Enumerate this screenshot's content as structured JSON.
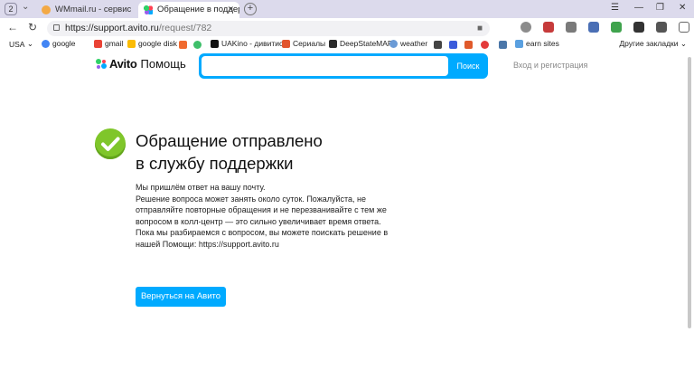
{
  "browser": {
    "tab_count": "2",
    "tabs": [
      {
        "title": "WMmail.ru - сервис почто",
        "active": false
      },
      {
        "title": "Обращение в поддержк",
        "active": true
      }
    ],
    "url_host": "https://support.avito.ru",
    "url_path": "/request/782",
    "bookmarks": [
      {
        "label": "USA"
      },
      {
        "label": "google"
      },
      {
        "label": "gmail"
      },
      {
        "label": "google disk"
      },
      {
        "label": "UAKino - дивитис"
      },
      {
        "label": "Сериалы"
      },
      {
        "label": "DeepStateMAP"
      },
      {
        "label": "weather"
      },
      {
        "label": "earn sites"
      }
    ],
    "other_bookmarks": "Другие закладки",
    "download_badge": "3"
  },
  "header": {
    "brand": "Avito",
    "help": "Помощь",
    "search_placeholder": "",
    "search_button": "Поиск",
    "login": "Вход и регистрация"
  },
  "main": {
    "title_line1": "Обращение отправлено",
    "title_line2": "в службу поддержки",
    "paragraphs": [
      "Мы пришлём ответ на вашу почту.",
      "Решение вопроса может занять около суток. Пожалуйста, не отправляйте повторные обращения и не перезванивайте с тем же вопросом в колл-центр — это сильно увеличивает время ответа.",
      "Пока мы разбираемся с вопросом, вы можете поискать решение в нашей Помощи: https://support.avito.ru"
    ],
    "back_button": "Вернуться на Авито"
  },
  "colors": {
    "accent": "#00aaff",
    "success": "#7fc62a",
    "titlebar": "#dcdaec"
  }
}
